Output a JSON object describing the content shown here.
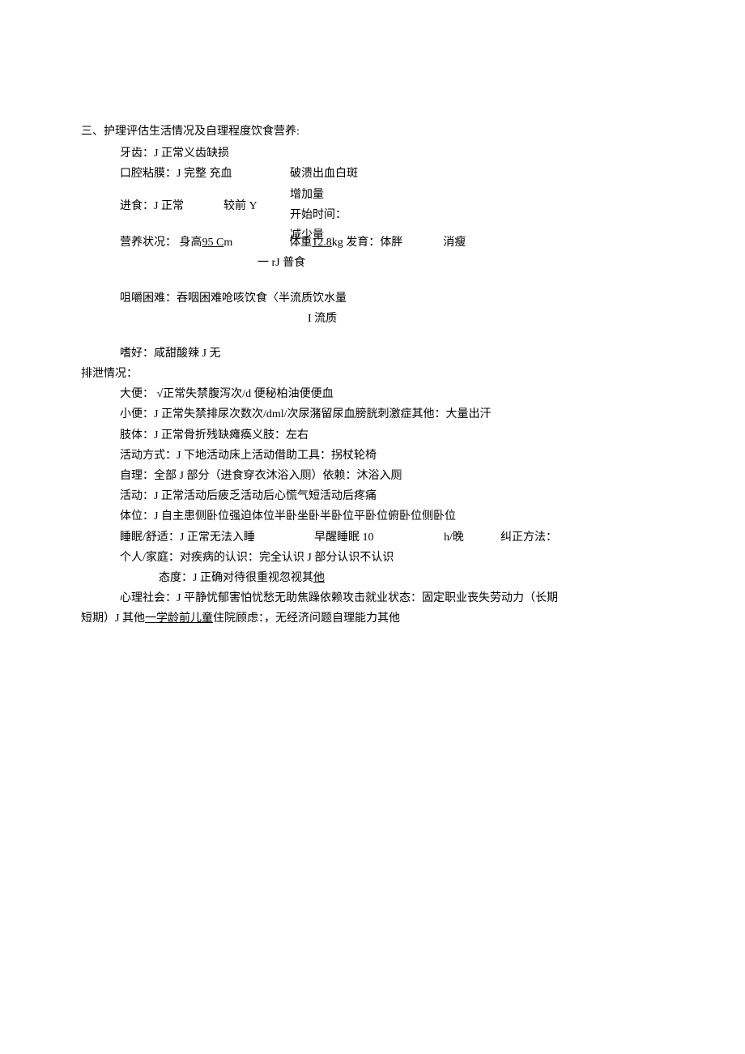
{
  "section3": {
    "title": "三、护理评估生活情况及自理程度饮食营养:",
    "teeth": "牙齿：J 正常义齿缺损",
    "oral_left": "口腔粘膜：J 完整  充血",
    "oral_right": "破溃出血白斑",
    "intake_left": "进食：J 正常",
    "intake_mid": "较前 Y",
    "intake_r1": "增加量",
    "intake_r2": "开始时间：",
    "intake_r3": "减少量",
    "nutrition_left": "营养状况：  身高  ",
    "height_val": "95 C",
    "height_unit": "m",
    "nutrition_mid": "体重 ",
    "weight_val": "12.8",
    "weight_tail": "kg 发育：体胖",
    "nutrition_right": "消瘦",
    "diet_line": "一 rJ 普食",
    "chew": "咀嚼困难：吞咽困难呛咳饮食〈半流质饮水量",
    "liquid": "I 流质",
    "pref": "嗜好：咸甜酸辣 J 无",
    "excretion_title": "排泄情况：",
    "stool": "大便：  √正常失禁腹泻次/d 便秘柏油便便血",
    "urine": "小便：J 正常失禁排尿次数次/dml/次尿潴留尿血膀胱刺激症其他：大量出汗",
    "limb": "肢体：J 正常骨折残缺瘫痪义肢：左右",
    "mobility": "活动方式：J 下地活动床上活动借助工具：拐杖轮椅",
    "selfcare": "自理：全部 J 部分（进食穿衣沐浴入厕）依赖：沐浴入厕",
    "activity": "活动：J 正常活动后疲乏活动后心慌气短活动后疼痛",
    "position": "体位：J 自主患侧卧位强迫体位半卧坐卧半卧位平卧位俯卧位侧卧位",
    "sleep_a": "睡眠/舒适：J 正常无法入睡",
    "sleep_b": "早醒睡眠 10",
    "sleep_c": "h/晚",
    "sleep_d": "纠正方法：",
    "family": "个人/家庭：对疾病的认识：完全认识 J 部分认识不认识",
    "attitude_a": "态度：J 正确对待很重视忽视其",
    "attitude_b": "他",
    "psych1": "心理社会：J 平静忧郁害怕忧愁无助焦躁依赖攻击就业状态：固定职业丧失劳动力（长期",
    "psych2_a": "短期）J 其他",
    "psych2_b": "一学龄前儿童",
    "psych2_c": "住院顾虑：，无经济问题自理能力其他"
  }
}
